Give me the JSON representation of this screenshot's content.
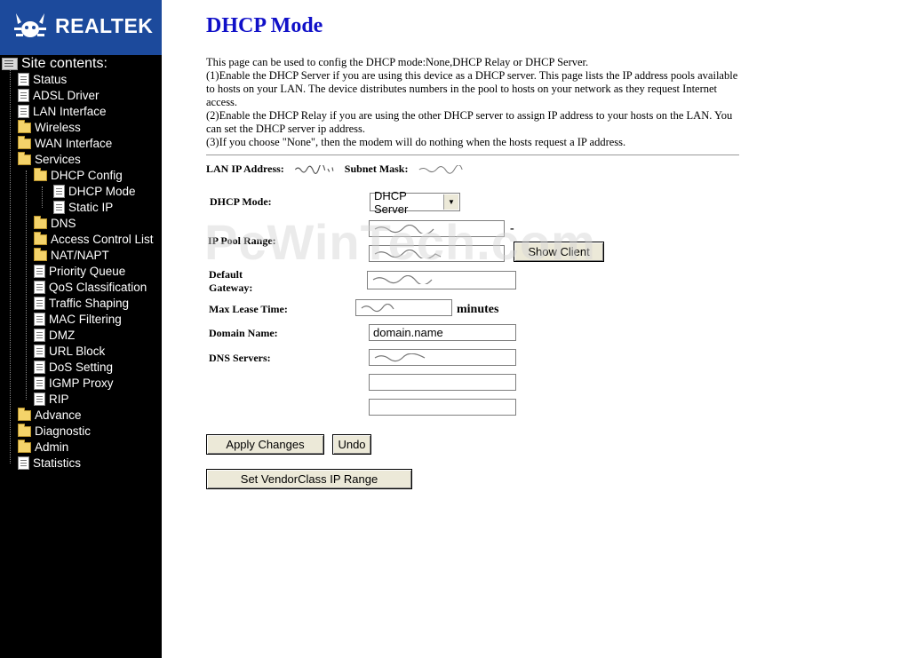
{
  "sidebar": {
    "brand": "Realtek",
    "root_label": "Site contents:",
    "items": [
      {
        "label": "Status",
        "type": "page",
        "level": 1
      },
      {
        "label": "ADSL Driver",
        "type": "page",
        "level": 1
      },
      {
        "label": "LAN Interface",
        "type": "page",
        "level": 1
      },
      {
        "label": "Wireless",
        "type": "folder",
        "level": 1
      },
      {
        "label": "WAN Interface",
        "type": "folder",
        "level": 1
      },
      {
        "label": "Services",
        "type": "folder-open",
        "level": 1
      },
      {
        "label": "DHCP Config",
        "type": "folder-open",
        "level": 2
      },
      {
        "label": "DHCP Mode",
        "type": "page",
        "level": 3
      },
      {
        "label": "Static IP",
        "type": "page",
        "level": 3
      },
      {
        "label": "DNS",
        "type": "folder",
        "level": 2
      },
      {
        "label": "Access Control List",
        "type": "folder",
        "level": 2
      },
      {
        "label": "NAT/NAPT",
        "type": "folder",
        "level": 2
      },
      {
        "label": "Priority Queue",
        "type": "page",
        "level": 2
      },
      {
        "label": "QoS Classification",
        "type": "page",
        "level": 2
      },
      {
        "label": "Traffic Shaping",
        "type": "page",
        "level": 2
      },
      {
        "label": "MAC Filtering",
        "type": "page",
        "level": 2
      },
      {
        "label": "DMZ",
        "type": "page",
        "level": 2
      },
      {
        "label": "URL Block",
        "type": "page",
        "level": 2
      },
      {
        "label": "DoS Setting",
        "type": "page",
        "level": 2
      },
      {
        "label": "IGMP Proxy",
        "type": "page",
        "level": 2
      },
      {
        "label": "RIP",
        "type": "page",
        "level": 2
      },
      {
        "label": "Advance",
        "type": "folder",
        "level": 1
      },
      {
        "label": "Diagnostic",
        "type": "folder",
        "level": 1
      },
      {
        "label": "Admin",
        "type": "folder",
        "level": 1
      },
      {
        "label": "Statistics",
        "type": "page",
        "level": 1
      }
    ]
  },
  "main": {
    "title": "DHCP Mode",
    "description": [
      "This page can be used to config the DHCP mode:None,DHCP Relay or DHCP Server.",
      "(1)Enable the DHCP Server if you are using this device as a DHCP server. This page lists the IP address pools available to hosts on your LAN. The device distributes numbers in the pool to hosts on your network as they request Internet access.",
      "(2)Enable the DHCP Relay if you are using the other DHCP server to assign IP address to your hosts on the LAN. You can set the DHCP server ip address.",
      "(3)If you choose \"None\", then the modem will do nothing when the hosts request a IP address."
    ],
    "lan_ip_label": "LAN IP Address:",
    "subnet_mask_label": "Subnet Mask:",
    "form": {
      "dhcp_mode_label": "DHCP Mode:",
      "dhcp_mode_value": "DHCP Server",
      "ip_pool_label": "IP Pool Range:",
      "pool_dash": "-",
      "show_client_button": "Show Client",
      "default_gateway_label": "Default Gateway:",
      "max_lease_label": "Max Lease Time:",
      "minutes_label": "minutes",
      "domain_name_label": "Domain Name:",
      "domain_name_value": "domain.name",
      "dns_servers_label": "DNS Servers:"
    },
    "buttons": {
      "apply": "Apply Changes",
      "undo": "Undo",
      "vendor_class": "Set VendorClass IP Range"
    },
    "watermark": "PcWinTech.com"
  },
  "colors": {
    "sidebar_bg": "#000000",
    "logo_bg": "#1c4a9c",
    "title": "#1010c8",
    "button_face": "#ece9d8"
  }
}
